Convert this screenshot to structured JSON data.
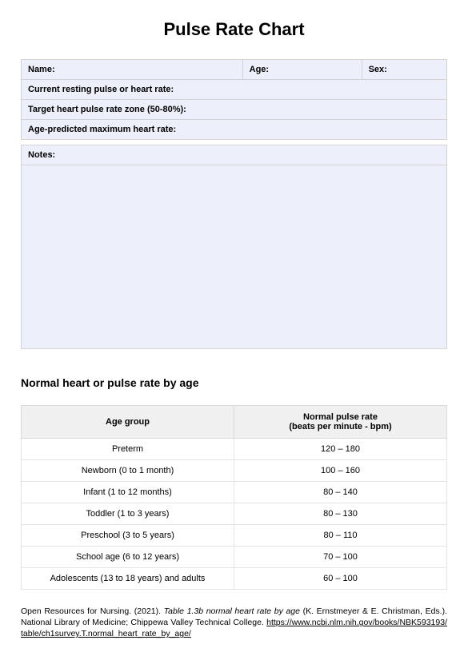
{
  "title": "Pulse Rate Chart",
  "form": {
    "name_label": "Name:",
    "age_label": "Age:",
    "sex_label": "Sex:",
    "resting_label": "Current resting pulse or heart rate:",
    "target_label": "Target heart pulse rate zone (50-80%):",
    "predicted_label": "Age-predicted maximum heart rate:",
    "notes_label": "Notes:"
  },
  "section_heading": "Normal heart or pulse rate by age",
  "table": {
    "header_age_group": "Age group",
    "header_rate_line1": "Normal pulse rate",
    "header_rate_line2": "(beats per minute - bpm)"
  },
  "chart_data": {
    "type": "table",
    "columns": [
      "Age group",
      "Normal pulse rate (beats per minute - bpm)"
    ],
    "rows": [
      {
        "age_group": "Preterm",
        "rate": "120 – 180"
      },
      {
        "age_group": "Newborn (0 to 1 month)",
        "rate": "100 – 160"
      },
      {
        "age_group": "Infant (1 to 12 months)",
        "rate": "80 – 140"
      },
      {
        "age_group": "Toddler (1 to 3 years)",
        "rate": "80 – 130"
      },
      {
        "age_group": "Preschool (3 to 5 years)",
        "rate": "80 – 110"
      },
      {
        "age_group": "School age (6 to 12 years)",
        "rate": "70 – 100"
      },
      {
        "age_group": "Adolescents (13 to 18 years) and adults",
        "rate": "60 – 100"
      }
    ]
  },
  "citation": {
    "part1": "Open Resources for Nursing. (2021). ",
    "italic": "Table 1.3b normal heart rate by age ",
    "part2": "(K. Ernstmeyer & E. Christman, Eds.). National Library of Medicine; Chippewa Valley Technical College. ",
    "link": "https://www.ncbi.nlm.nih.gov/books/NBK593193/table/ch1survey.T.normal_heart_rate_by_age/"
  }
}
